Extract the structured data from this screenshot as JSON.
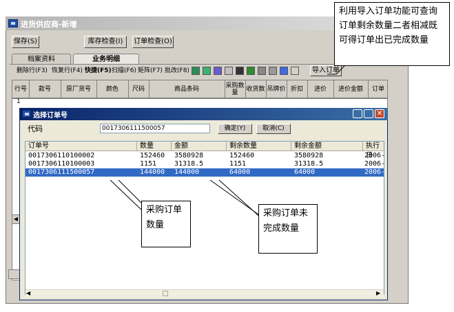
{
  "main_window": {
    "title": "进货供应商-新增",
    "buttons": {
      "save": "保存(S)",
      "stock_check": "库存检查(I)",
      "order_check": "订单检查(O)"
    },
    "tabs": [
      "档案资料",
      "业务明细"
    ],
    "toolbar": {
      "delete_row": "删除行(F3)",
      "restore_row": "恢复行(F4)",
      "quick": "快捷(F5)",
      "scan": "扫描(F6)",
      "matrix": "矩阵(F7)",
      "batch_edit": "批改(F8)",
      "import_order": "导入订单"
    },
    "grid_headers": [
      "行号",
      "款号",
      "原厂货号",
      "颜色",
      "尺码",
      "商品条码",
      "采购数量",
      "收货数",
      "吊牌价",
      "折扣",
      "进价",
      "进价金额",
      "订单"
    ],
    "grid_first_row": "1"
  },
  "dialog": {
    "title": "选择订单号",
    "code_label": "代码",
    "code_value": "0017306111500057",
    "ok_button": "确定(Y)",
    "cancel_button": "取消(C)",
    "columns": [
      "订单号",
      "数量",
      "金额",
      "剩余数量",
      "剩余金额",
      "执行日"
    ],
    "rows": [
      [
        "0017306110100002",
        "152460",
        "3580928",
        "152460",
        "3580928",
        "2006-"
      ],
      [
        "0017306110100003",
        "1151",
        "31318.5",
        "1151",
        "31318.5",
        "2006-"
      ],
      [
        "0017306111500057",
        "144000",
        "144000",
        "64000",
        "64000",
        "2006-"
      ]
    ],
    "selected_row": 2
  },
  "callouts": {
    "top": "利用导入订单功能可查询订单剩余数量二者相减既可得订单出已完成数量",
    "left": "采购订单数量",
    "right": "采购订单未完成数量"
  },
  "colors": {
    "dialog_title": "#0a246a",
    "selection": "#316ac5",
    "window_bg": "#d4d0c8"
  }
}
